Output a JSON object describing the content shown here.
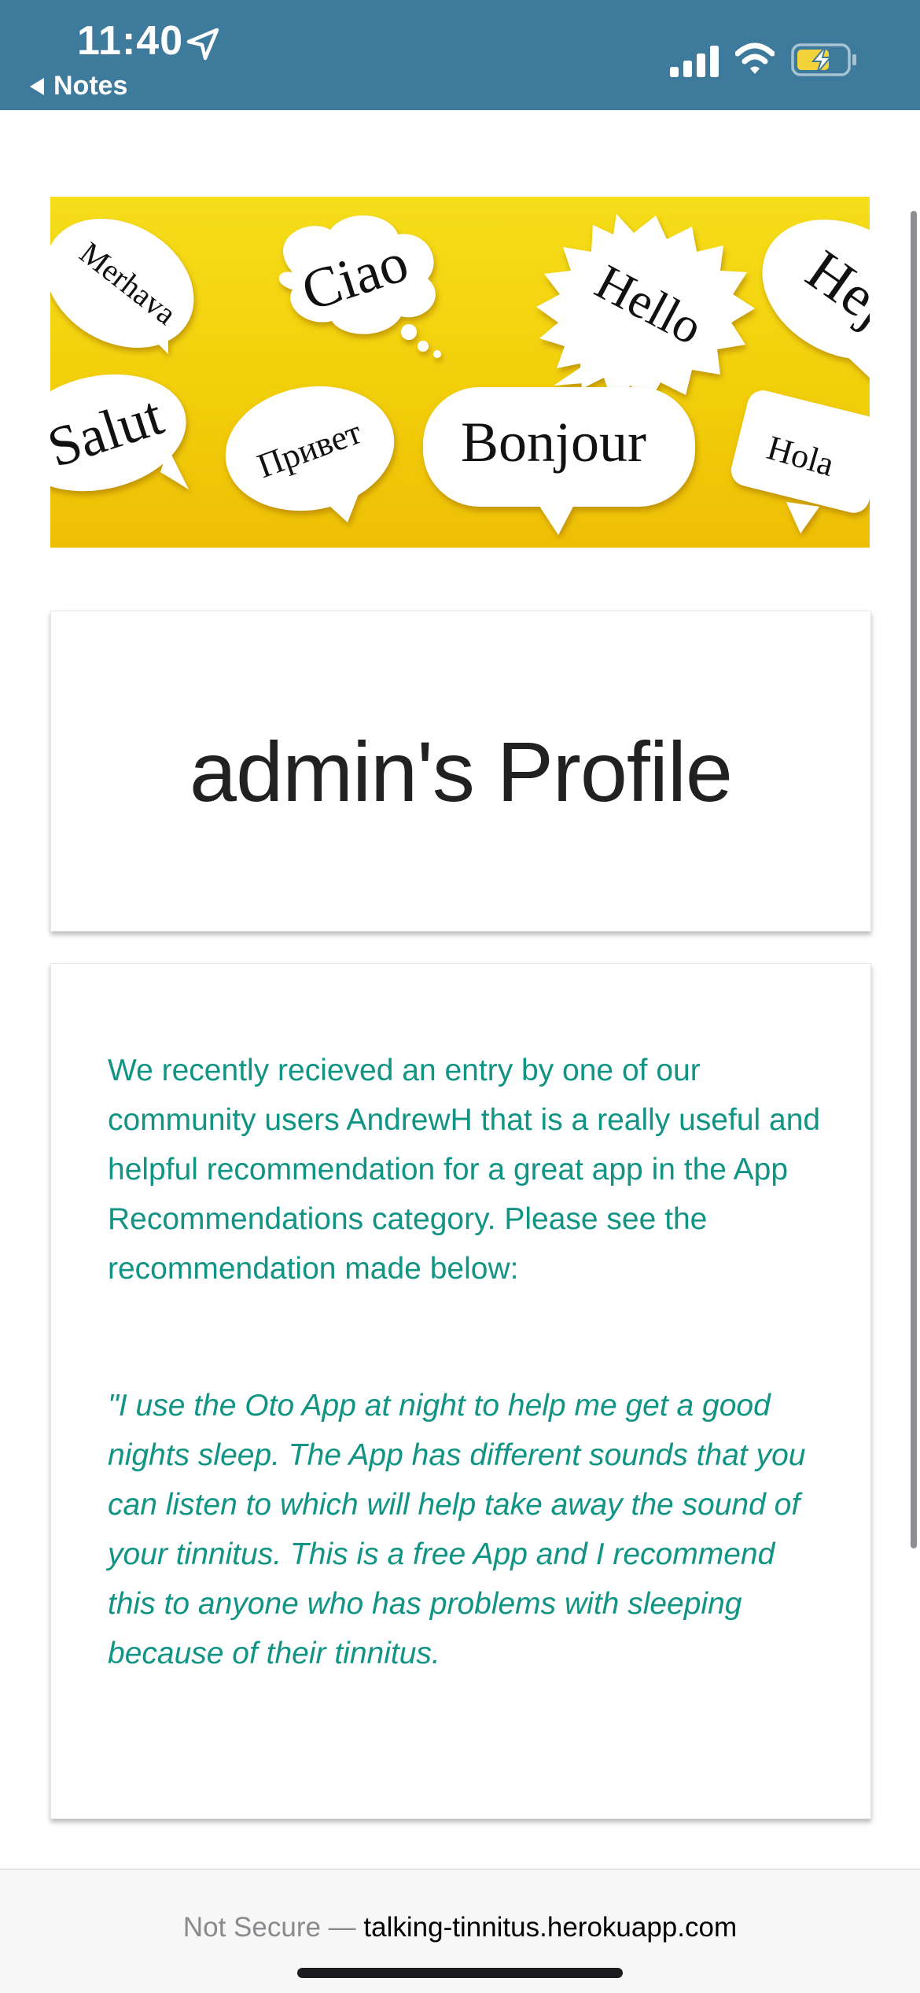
{
  "status_bar": {
    "time": "11:40",
    "back_label": "Notes",
    "icons": [
      "location-arrow-icon",
      "cellular-signal-icon",
      "wifi-icon",
      "battery-charging-icon"
    ],
    "background_color": "#3e7a9c"
  },
  "hero_banner": {
    "background_color": "#f2cf0a",
    "bubbles": {
      "merhava": "Merhava",
      "ciao": "Ciao",
      "hello": "Hello",
      "hej": "Hej",
      "salut": "Salut",
      "privet": "Привет",
      "bonjour": "Bonjour",
      "hola": "Hola"
    }
  },
  "profile": {
    "title": "admin's Profile"
  },
  "entry": {
    "intro": "We recently recieved an entry by one of our community users AndrewH that is a really useful and helpful recommendation for a great app in the App Recommendations category. Please see the recommendation made below:",
    "quote": "\"I use the Oto App at night to help me get a good nights sleep. The App has different sounds that you can listen to which will help take away the sound of your tinnitus. This is a free App and I recommend this to anyone who has problems with sleeping because of their tinnitus.",
    "text_color": "#119484"
  },
  "url_bar": {
    "security_label": "Not Secure —",
    "domain": "talking-tinnitus.herokuapp.com"
  }
}
